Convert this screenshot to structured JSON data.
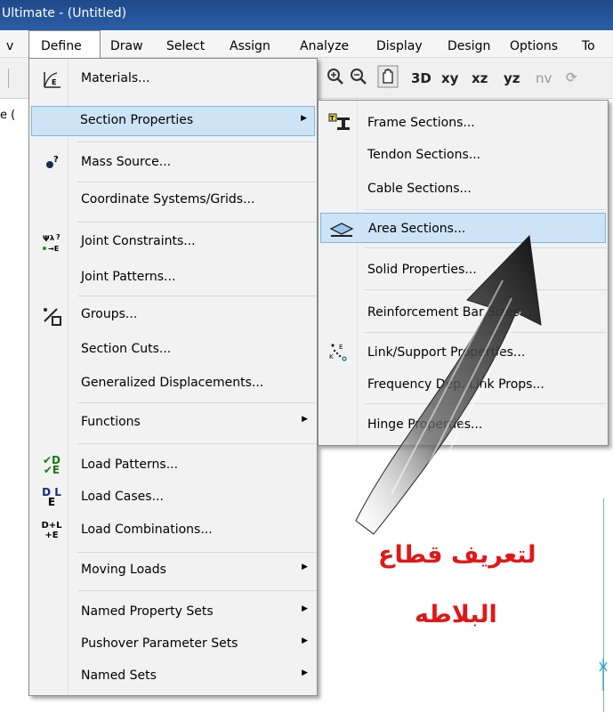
{
  "window": {
    "title": "Ultimate  - (Untitled)"
  },
  "menubar": [
    "v",
    "Define",
    "Draw",
    "Select",
    "Assign",
    "Analyze",
    "Display",
    "Design",
    "Options",
    "To"
  ],
  "toolbar": {
    "xy": "xy",
    "xz": "xz",
    "yz": "yz",
    "nv": "nv",
    "three_d": "3D"
  },
  "canvas": {
    "partial_label": "e ("
  },
  "define_menu": {
    "items": [
      {
        "label": "Materials...",
        "icon": "materials-icon",
        "submenu": false
      },
      {
        "label": "Section Properties",
        "icon": "",
        "submenu": true,
        "highlighted": true
      },
      {
        "label": "Mass Source...",
        "icon": "mass-source-icon",
        "submenu": false
      },
      {
        "label": "Coordinate Systems/Grids...",
        "icon": "",
        "submenu": false
      },
      {
        "label": "Joint Constraints...",
        "icon": "joint-constraints-icon",
        "submenu": false
      },
      {
        "label": "Joint Patterns...",
        "icon": "",
        "submenu": false
      },
      {
        "label": "Groups...",
        "icon": "groups-icon",
        "submenu": false
      },
      {
        "label": "Section Cuts...",
        "icon": "",
        "submenu": false
      },
      {
        "label": "Generalized Displacements...",
        "icon": "",
        "submenu": false
      },
      {
        "label": "Functions",
        "icon": "",
        "submenu": true
      },
      {
        "label": "Load Patterns...",
        "icon": "load-patterns-icon",
        "submenu": false
      },
      {
        "label": "Load Cases...",
        "icon": "load-cases-icon",
        "submenu": false
      },
      {
        "label": "Load Combinations...",
        "icon": "load-combinations-icon",
        "submenu": false
      },
      {
        "label": "Moving Loads",
        "icon": "",
        "submenu": true
      },
      {
        "label": "Named Property Sets",
        "icon": "",
        "submenu": true
      },
      {
        "label": "Pushover Parameter Sets",
        "icon": "",
        "submenu": true
      },
      {
        "label": "Named Sets",
        "icon": "",
        "submenu": true
      }
    ],
    "icon_text": {
      "load_patterns": [
        "✔D",
        "✔E"
      ],
      "load_cases": [
        "D L",
        "E"
      ],
      "load_combinations": [
        "D+L",
        "+E"
      ]
    }
  },
  "section_submenu": {
    "items": [
      {
        "label": "Frame Sections...",
        "icon": "frame-sections-icon"
      },
      {
        "label": "Tendon Sections...",
        "icon": ""
      },
      {
        "label": "Cable Sections...",
        "icon": ""
      },
      {
        "label": "Area Sections...",
        "icon": "area-sections-icon",
        "highlighted": true
      },
      {
        "label": "Solid Properties...",
        "icon": ""
      },
      {
        "label": "Reinforcement Bar Sizes...",
        "icon": ""
      },
      {
        "label": "Link/Support Properties...",
        "icon": "link-support-icon"
      },
      {
        "label": "Frequency Dep. Link Props...",
        "icon": ""
      },
      {
        "label": "Hinge Properties...",
        "icon": ""
      }
    ]
  },
  "annotation": {
    "line1": "لتعريف قطاع",
    "line2": "البلاطه",
    "color": "#e01818"
  },
  "colors": {
    "highlight_bg": "#cde4f7",
    "highlight_border": "#7eb4ea",
    "titlebar": "#1f4a8a"
  }
}
